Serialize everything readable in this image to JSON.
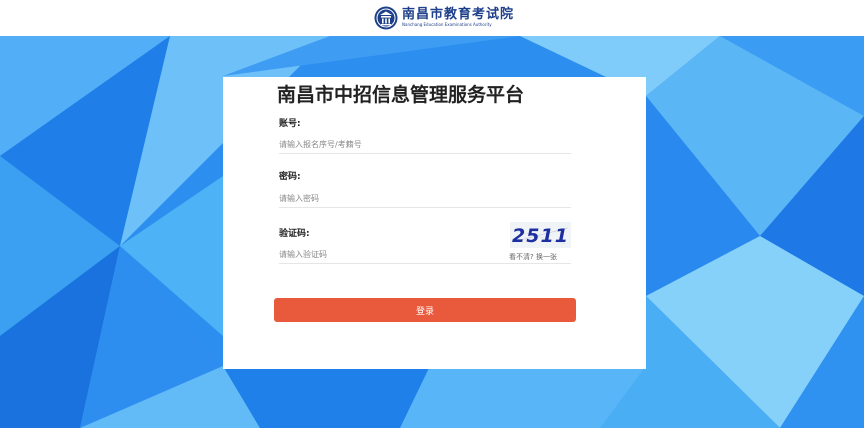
{
  "header": {
    "logo_cn": "南昌市教育考试院",
    "logo_en": "Nanchang Education Examinations Authority"
  },
  "form": {
    "title": "南昌市中招信息管理服务平台",
    "account_label": "账号:",
    "account_placeholder": "请输入报名序号/考籍号",
    "password_label": "密码:",
    "password_placeholder": "请输入密码",
    "captcha_label": "验证码:",
    "captcha_placeholder": "请输入验证码",
    "captcha_text": "2511",
    "refresh_text": "看不清? 换一张",
    "login_label": "登录"
  },
  "colors": {
    "login_button": "#e95a3c",
    "background_blue": "#2b8ff0"
  }
}
